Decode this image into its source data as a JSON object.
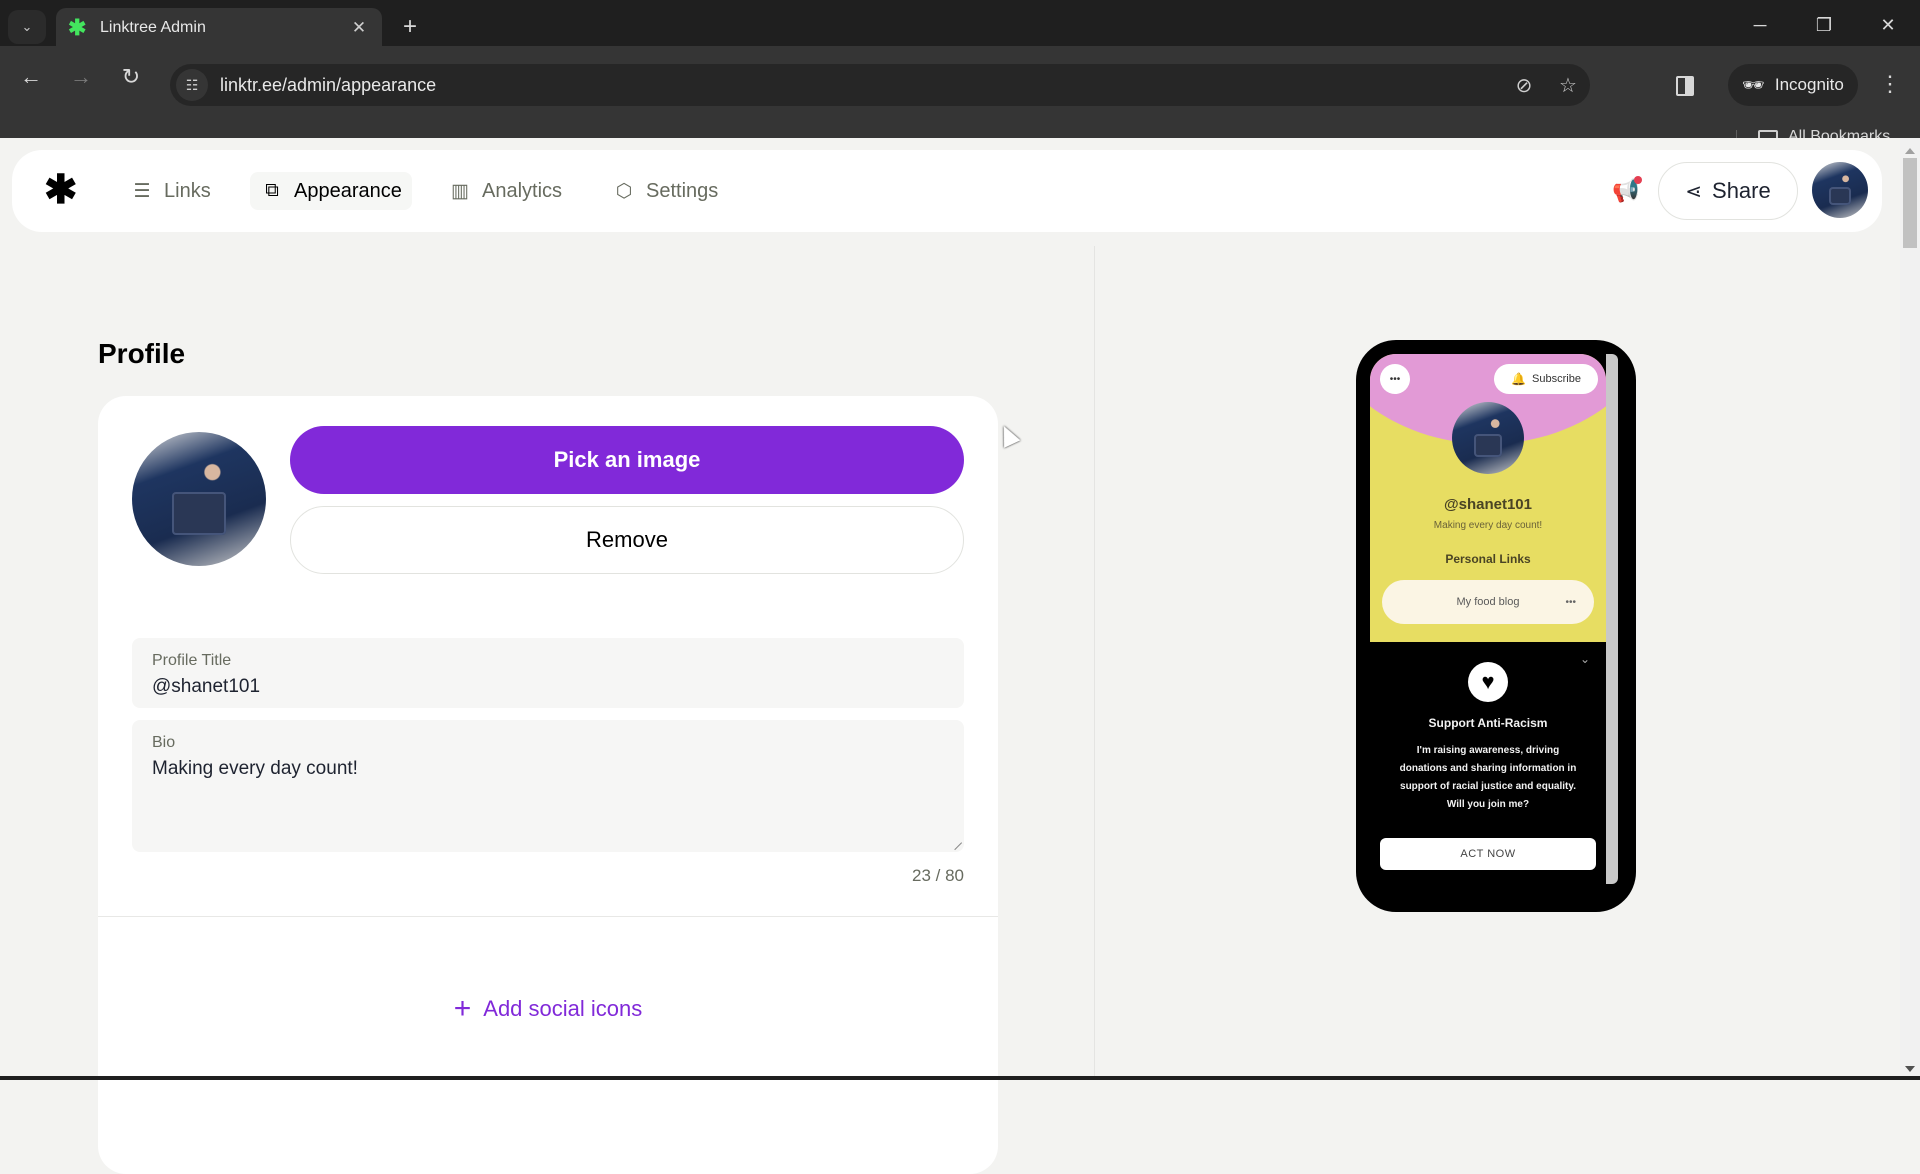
{
  "browser": {
    "tab_title": "Linktree Admin",
    "url": "linktr.ee/admin/appearance",
    "incognito_label": "Incognito",
    "bookmarks_label": "All Bookmarks",
    "icons": {
      "tab_search": "chevron-down-icon",
      "new_tab": "plus-icon",
      "back": "arrow-left-icon",
      "forward": "arrow-right-icon",
      "reload": "reload-icon",
      "site_info": "tune-icon",
      "eye_off": "eye-off-icon",
      "star": "star-icon"
    }
  },
  "nav": {
    "items": [
      {
        "label": "Links",
        "icon": "links-icon"
      },
      {
        "label": "Appearance",
        "icon": "appearance-icon",
        "active": true
      },
      {
        "label": "Analytics",
        "icon": "analytics-icon"
      },
      {
        "label": "Settings",
        "icon": "settings-icon"
      }
    ],
    "share_label": "Share"
  },
  "profile": {
    "section_title": "Profile",
    "pick_image_label": "Pick an image",
    "remove_label": "Remove",
    "title_label": "Profile Title",
    "title_value": "@shanet101",
    "bio_label": "Bio",
    "bio_value": "Making every day count!",
    "bio_counter": "23 / 80",
    "add_social_label": "Add social icons"
  },
  "preview": {
    "subscribe_label": "Subscribe",
    "handle": "@shanet101",
    "bio": "Making every day count!",
    "section_title": "Personal Links",
    "link_label": "My food blog",
    "card_title": "Support Anti-Racism",
    "card_body": "I'm raising awareness, driving donations and sharing information in support of racial justice and equality. Will you join me?",
    "cta_label": "ACT NOW"
  },
  "colors": {
    "accent": "#8129d9",
    "notification_dot": "#e43f52",
    "preview_pink": "#e29ad6",
    "preview_yellow": "#e7dd62"
  }
}
